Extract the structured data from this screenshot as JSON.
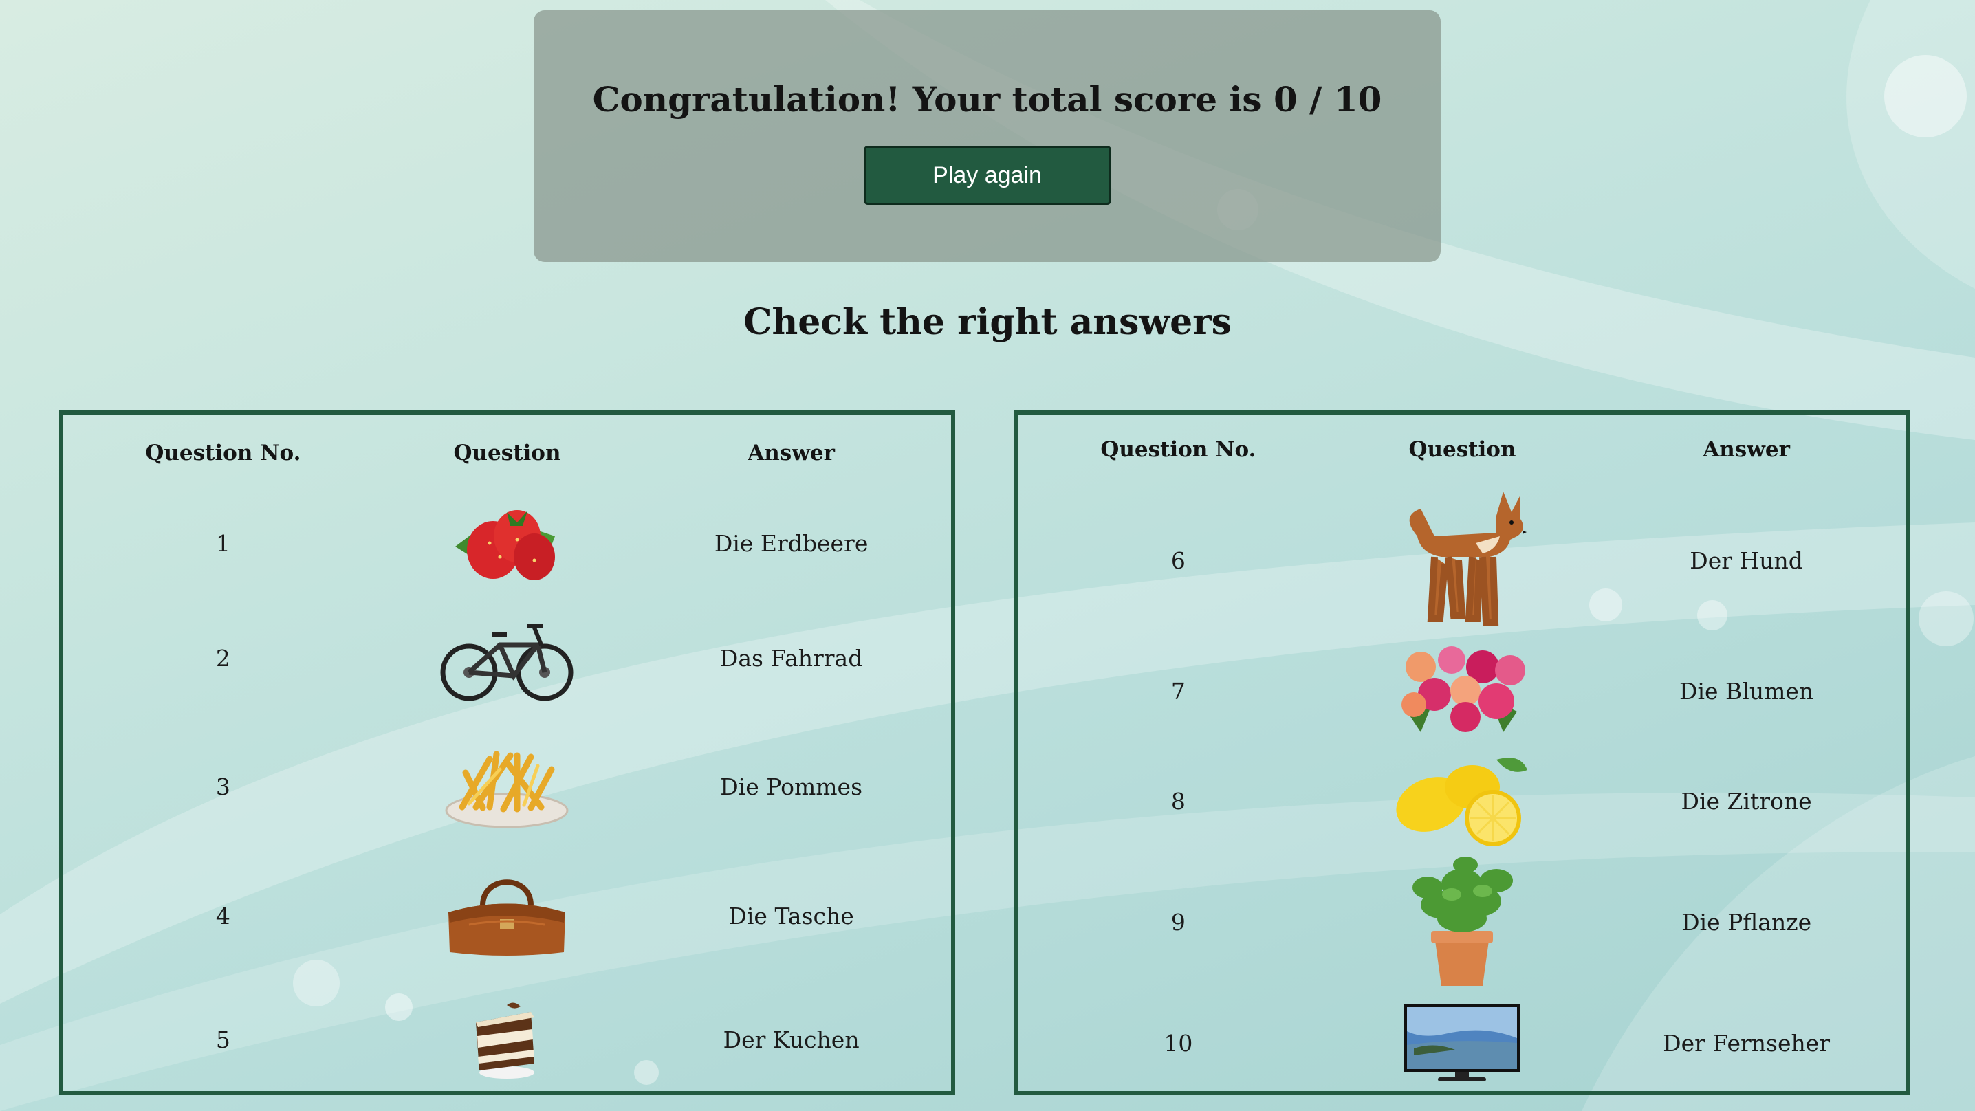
{
  "result": {
    "score_message": "Congratulation! Your total score is 0 / 10",
    "play_again_label": "Play again"
  },
  "check_title": "Check the right answers",
  "table_headers": {
    "number": "Question No.",
    "question": "Question",
    "answer": "Answer"
  },
  "left_table": [
    {
      "no": "1",
      "image": "strawberry-image",
      "answer": "Die Erdbeere"
    },
    {
      "no": "2",
      "image": "bicycle-image",
      "answer": "Das Fahrrad"
    },
    {
      "no": "3",
      "image": "fries-image",
      "answer": "Die Pommes"
    },
    {
      "no": "4",
      "image": "bag-image",
      "answer": "Die Tasche"
    },
    {
      "no": "5",
      "image": "cake-image",
      "answer": "Der Kuchen"
    }
  ],
  "right_table": [
    {
      "no": "6",
      "image": "dog-image",
      "answer": "Der Hund"
    },
    {
      "no": "7",
      "image": "flowers-image",
      "answer": "Die Blumen"
    },
    {
      "no": "8",
      "image": "lemon-image",
      "answer": "Die Zitrone"
    },
    {
      "no": "9",
      "image": "plant-image",
      "answer": "Die Pflanze"
    },
    {
      "no": "10",
      "image": "tv-image",
      "answer": "Der Fernseher"
    }
  ],
  "colors": {
    "accent": "#225a40",
    "panel_border": "#225a40",
    "score_box": "#8b978e"
  }
}
